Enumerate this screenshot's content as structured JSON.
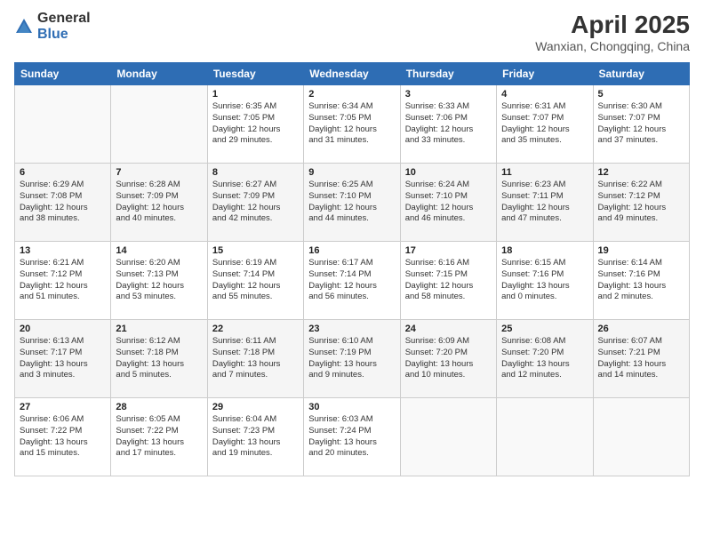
{
  "logo": {
    "general": "General",
    "blue": "Blue"
  },
  "title": {
    "month_year": "April 2025",
    "location": "Wanxian, Chongqing, China"
  },
  "weekdays": [
    "Sunday",
    "Monday",
    "Tuesday",
    "Wednesday",
    "Thursday",
    "Friday",
    "Saturday"
  ],
  "weeks": [
    [
      {
        "day": "",
        "info": ""
      },
      {
        "day": "",
        "info": ""
      },
      {
        "day": "1",
        "info": "Sunrise: 6:35 AM\nSunset: 7:05 PM\nDaylight: 12 hours\nand 29 minutes."
      },
      {
        "day": "2",
        "info": "Sunrise: 6:34 AM\nSunset: 7:05 PM\nDaylight: 12 hours\nand 31 minutes."
      },
      {
        "day": "3",
        "info": "Sunrise: 6:33 AM\nSunset: 7:06 PM\nDaylight: 12 hours\nand 33 minutes."
      },
      {
        "day": "4",
        "info": "Sunrise: 6:31 AM\nSunset: 7:07 PM\nDaylight: 12 hours\nand 35 minutes."
      },
      {
        "day": "5",
        "info": "Sunrise: 6:30 AM\nSunset: 7:07 PM\nDaylight: 12 hours\nand 37 minutes."
      }
    ],
    [
      {
        "day": "6",
        "info": "Sunrise: 6:29 AM\nSunset: 7:08 PM\nDaylight: 12 hours\nand 38 minutes."
      },
      {
        "day": "7",
        "info": "Sunrise: 6:28 AM\nSunset: 7:09 PM\nDaylight: 12 hours\nand 40 minutes."
      },
      {
        "day": "8",
        "info": "Sunrise: 6:27 AM\nSunset: 7:09 PM\nDaylight: 12 hours\nand 42 minutes."
      },
      {
        "day": "9",
        "info": "Sunrise: 6:25 AM\nSunset: 7:10 PM\nDaylight: 12 hours\nand 44 minutes."
      },
      {
        "day": "10",
        "info": "Sunrise: 6:24 AM\nSunset: 7:10 PM\nDaylight: 12 hours\nand 46 minutes."
      },
      {
        "day": "11",
        "info": "Sunrise: 6:23 AM\nSunset: 7:11 PM\nDaylight: 12 hours\nand 47 minutes."
      },
      {
        "day": "12",
        "info": "Sunrise: 6:22 AM\nSunset: 7:12 PM\nDaylight: 12 hours\nand 49 minutes."
      }
    ],
    [
      {
        "day": "13",
        "info": "Sunrise: 6:21 AM\nSunset: 7:12 PM\nDaylight: 12 hours\nand 51 minutes."
      },
      {
        "day": "14",
        "info": "Sunrise: 6:20 AM\nSunset: 7:13 PM\nDaylight: 12 hours\nand 53 minutes."
      },
      {
        "day": "15",
        "info": "Sunrise: 6:19 AM\nSunset: 7:14 PM\nDaylight: 12 hours\nand 55 minutes."
      },
      {
        "day": "16",
        "info": "Sunrise: 6:17 AM\nSunset: 7:14 PM\nDaylight: 12 hours\nand 56 minutes."
      },
      {
        "day": "17",
        "info": "Sunrise: 6:16 AM\nSunset: 7:15 PM\nDaylight: 12 hours\nand 58 minutes."
      },
      {
        "day": "18",
        "info": "Sunrise: 6:15 AM\nSunset: 7:16 PM\nDaylight: 13 hours\nand 0 minutes."
      },
      {
        "day": "19",
        "info": "Sunrise: 6:14 AM\nSunset: 7:16 PM\nDaylight: 13 hours\nand 2 minutes."
      }
    ],
    [
      {
        "day": "20",
        "info": "Sunrise: 6:13 AM\nSunset: 7:17 PM\nDaylight: 13 hours\nand 3 minutes."
      },
      {
        "day": "21",
        "info": "Sunrise: 6:12 AM\nSunset: 7:18 PM\nDaylight: 13 hours\nand 5 minutes."
      },
      {
        "day": "22",
        "info": "Sunrise: 6:11 AM\nSunset: 7:18 PM\nDaylight: 13 hours\nand 7 minutes."
      },
      {
        "day": "23",
        "info": "Sunrise: 6:10 AM\nSunset: 7:19 PM\nDaylight: 13 hours\nand 9 minutes."
      },
      {
        "day": "24",
        "info": "Sunrise: 6:09 AM\nSunset: 7:20 PM\nDaylight: 13 hours\nand 10 minutes."
      },
      {
        "day": "25",
        "info": "Sunrise: 6:08 AM\nSunset: 7:20 PM\nDaylight: 13 hours\nand 12 minutes."
      },
      {
        "day": "26",
        "info": "Sunrise: 6:07 AM\nSunset: 7:21 PM\nDaylight: 13 hours\nand 14 minutes."
      }
    ],
    [
      {
        "day": "27",
        "info": "Sunrise: 6:06 AM\nSunset: 7:22 PM\nDaylight: 13 hours\nand 15 minutes."
      },
      {
        "day": "28",
        "info": "Sunrise: 6:05 AM\nSunset: 7:22 PM\nDaylight: 13 hours\nand 17 minutes."
      },
      {
        "day": "29",
        "info": "Sunrise: 6:04 AM\nSunset: 7:23 PM\nDaylight: 13 hours\nand 19 minutes."
      },
      {
        "day": "30",
        "info": "Sunrise: 6:03 AM\nSunset: 7:24 PM\nDaylight: 13 hours\nand 20 minutes."
      },
      {
        "day": "",
        "info": ""
      },
      {
        "day": "",
        "info": ""
      },
      {
        "day": "",
        "info": ""
      }
    ]
  ]
}
